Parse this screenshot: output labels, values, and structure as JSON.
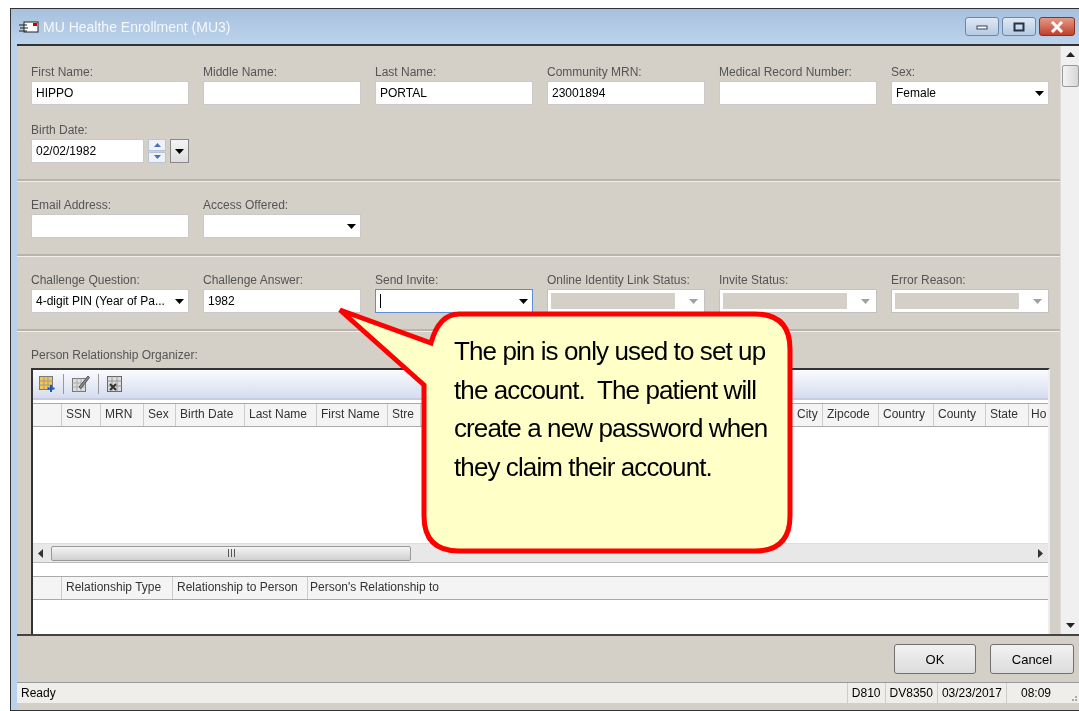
{
  "window": {
    "title": "MU Healthe Enrollment (MU3)"
  },
  "sections": [
    {
      "fields": [
        {
          "label": "First Name:",
          "kind": "text",
          "value": "HIPPO"
        },
        {
          "label": "Middle Name:",
          "kind": "text"
        },
        {
          "label": "Last Name:",
          "kind": "text",
          "value": "PORTAL"
        },
        {
          "label": "Community MRN:",
          "kind": "text",
          "value": "23001894"
        },
        {
          "label": "Medical Record Number:",
          "kind": "text"
        },
        {
          "label": "Sex:",
          "kind": "combo",
          "value": "Female",
          "disabled": false,
          "focused": false
        },
        {
          "label": "Birth Date:",
          "kind": "date",
          "value": "02/02/1982"
        }
      ]
    },
    {
      "fields": [
        {
          "label": "Email Address:",
          "kind": "text"
        },
        {
          "label": "Access Offered:",
          "kind": "combo",
          "disabled": false,
          "focused": false
        }
      ]
    },
    {
      "fields": [
        {
          "label": "Challenge Question:",
          "kind": "combo",
          "value": "4-digit PIN (Year of Pa...",
          "disabled": false,
          "focused": false
        },
        {
          "label": "Challenge Answer:",
          "kind": "text",
          "value": "1982"
        },
        {
          "label": "Send Invite:",
          "kind": "combo",
          "disabled": false,
          "focused": true
        },
        {
          "label": "Online Identity Link Status:",
          "kind": "combo",
          "disabled": true,
          "focused": false
        },
        {
          "label": "Invite Status:",
          "kind": "combo",
          "disabled": true,
          "focused": false
        },
        {
          "label": "Error Reason:",
          "kind": "combo",
          "disabled": true,
          "focused": false
        }
      ]
    }
  ],
  "organizer": {
    "label": "Person Relationship Organizer:",
    "columns": [
      "SSN",
      "MRN",
      "Sex",
      "Birth Date",
      "Last Name",
      "First Name",
      "Stre",
      "City",
      "Zipcode",
      "Country",
      "County",
      "State",
      "Ho"
    ],
    "relationship_columns": [
      "Relationship Type",
      "Relationship to Person",
      "Person's Relationship to"
    ]
  },
  "callout": {
    "text": "The pin is only used to set up the account.  The patient will create a new password when they claim their account."
  },
  "buttons": [
    {
      "label": "OK"
    },
    {
      "label": "Cancel"
    }
  ],
  "status_bar": {
    "message": "Ready",
    "items": [
      "D810",
      "DV8350",
      "03/23/2017",
      "08:09"
    ]
  }
}
